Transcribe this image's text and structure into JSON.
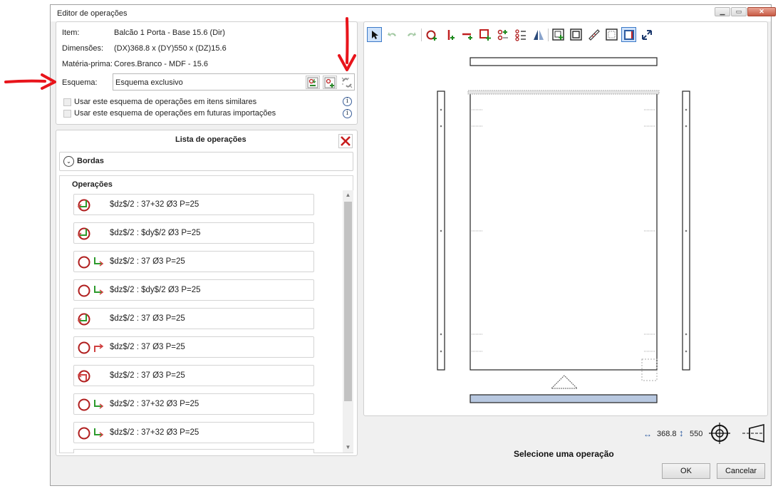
{
  "window": {
    "title": "Editor de operações"
  },
  "info": {
    "item_label": "Item:",
    "item_value": "Balcão 1 Porta - Base 15.6 (Dir)",
    "dim_label": "Dimensões:",
    "dim_value": "(DX)368.8 x (DY)550 x (DZ)15.6",
    "material_label": "Matéria-prima:",
    "material_value": "Cores.Branco - MDF - 15.6",
    "schema_label": "Esquema:",
    "schema_value": "Esquema exclusivo"
  },
  "checkboxes": [
    "Usar este esquema de operações em itens similares",
    "Usar este esquema de operações em futuras importações"
  ],
  "operations_panel": {
    "title": "Lista de operações",
    "borders_label": "Bordas",
    "operations_label": "Operações"
  },
  "operations": [
    "$dz$/2 : 37+32 Ø3 P=25",
    "$dz$/2 : $dy$/2 Ø3 P=25",
    "$dz$/2 : 37 Ø3 P=25",
    "$dz$/2 : $dy$/2 Ø3 P=25",
    "$dz$/2 : 37 Ø3 P=25",
    "$dz$/2 : 37 Ø3 P=25",
    "$dz$/2 : 37 Ø3 P=25",
    "$dz$/2 : 37+32 Ø3 P=25",
    "$dz$/2 : 37+32 Ø3 P=25"
  ],
  "status": {
    "dx": "368.8",
    "dy": "550",
    "message": "Selecione uma operação"
  },
  "buttons": {
    "ok": "OK",
    "cancel": "Cancelar"
  },
  "colors": {
    "annotation_arrow": "#e8141b",
    "bottom_edge_fill": "#b8c8e0",
    "selected_tool": "#cfe2fa"
  }
}
